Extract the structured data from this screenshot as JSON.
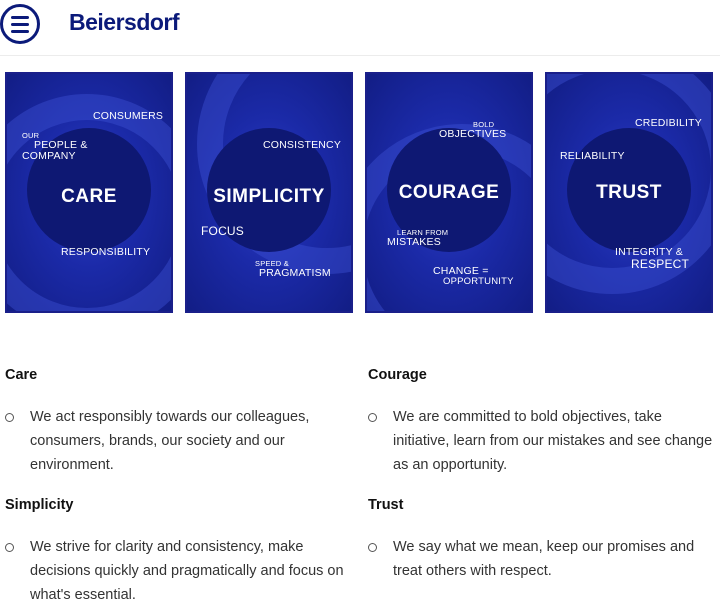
{
  "header": {
    "logo": "Beiersdorf",
    "menu_icon": "hamburger-menu-icon"
  },
  "cards": [
    {
      "title": "CARE",
      "labels": {
        "consumers": "CONSUMERS",
        "our": "OUR",
        "people": "PEOPLE &",
        "company": "COMPANY",
        "responsibility": "RESPONSIBILITY"
      }
    },
    {
      "title": "SIMPLICITY",
      "labels": {
        "consistency": "CONSISTENCY",
        "focus": "FOCUS",
        "speed": "SPEED &",
        "pragmatism": "PRAGMATISM"
      }
    },
    {
      "title": "COURAGE",
      "labels": {
        "bold": "BOLD",
        "objectives": "OBJECTIVES",
        "learn": "LEARN FROM",
        "mistakes": "MISTAKES",
        "change": "CHANGE =",
        "opportunity": "OPPORTUNITY"
      }
    },
    {
      "title": "TRUST",
      "labels": {
        "credibility": "CREDIBILITY",
        "reliability": "RELIABILITY",
        "integrity": "INTEGRITY &",
        "respect": "RESPECT"
      }
    }
  ],
  "values": {
    "care": {
      "heading": "Care",
      "text": "We act responsibly towards our colleagues, consumers, brands, our society and our environment."
    },
    "simplicity": {
      "heading": "Simplicity",
      "text": "We strive for clarity and consistency, make decisions quickly and pragmatically and focus on what's essential."
    },
    "courage": {
      "heading": "Courage",
      "text": "We are committed to bold objectives, take initiative, learn from our mistakes and see change as an opportunity."
    },
    "trust": {
      "heading": "Trust",
      "text": "We say what we mean, keep our promises and treat others with respect."
    }
  }
}
